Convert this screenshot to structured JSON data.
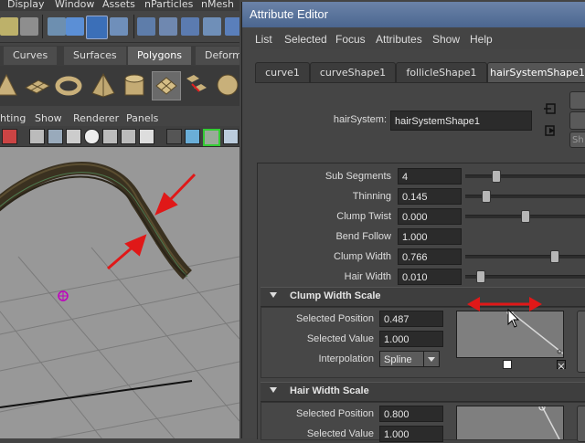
{
  "maya": {
    "menubar": [
      "Display",
      "Window",
      "Assets",
      "nParticles",
      "nMesh"
    ],
    "shelf_tabs": [
      "Curves",
      "Surfaces",
      "Polygons",
      "Deformat"
    ],
    "active_shelf_tab": "Polygons",
    "panel_menu": [
      "hting",
      "Show",
      "Renderer",
      "Panels"
    ]
  },
  "ae": {
    "title": "Attribute Editor",
    "menus": [
      "List",
      "Selected",
      "Focus",
      "Attributes",
      "Show",
      "Help"
    ],
    "tabs": [
      "curve1",
      "curveShape1",
      "follicleShape1",
      "hairSystemShape1"
    ],
    "active_tab": "hairSystemShape1",
    "node_label": "hairSystem:",
    "node_value": "hairSystemShape1",
    "side_button_label": "Sh",
    "attributes": [
      {
        "label": "Sub Segments",
        "value": "4",
        "slider": 0.24
      },
      {
        "label": "Thinning",
        "value": "0.145",
        "slider": 0.145
      },
      {
        "label": "Clump Twist",
        "value": "0.000",
        "slider": 0.5
      },
      {
        "label": "Bend Follow",
        "value": "1.000"
      },
      {
        "label": "Clump Width",
        "value": "0.766",
        "slider": 0.766
      },
      {
        "label": "Hair Width",
        "value": "0.010",
        "slider": 0.1
      }
    ],
    "clump_section": {
      "title": "Clump Width Scale",
      "selected_position_label": "Selected Position",
      "selected_position": "0.487",
      "selected_value_label": "Selected Value",
      "selected_value": "1.000",
      "interpolation_label": "Interpolation",
      "interpolation": "Spline"
    },
    "hair_section": {
      "title": "Hair Width Scale",
      "selected_position_label": "Selected Position",
      "selected_position": "0.800",
      "selected_value_label": "Selected Value",
      "selected_value": "1.000"
    }
  },
  "colors": {
    "annotation_arrow": "#e01818",
    "title_bar": "#5b739c",
    "viewport": "#989898"
  }
}
